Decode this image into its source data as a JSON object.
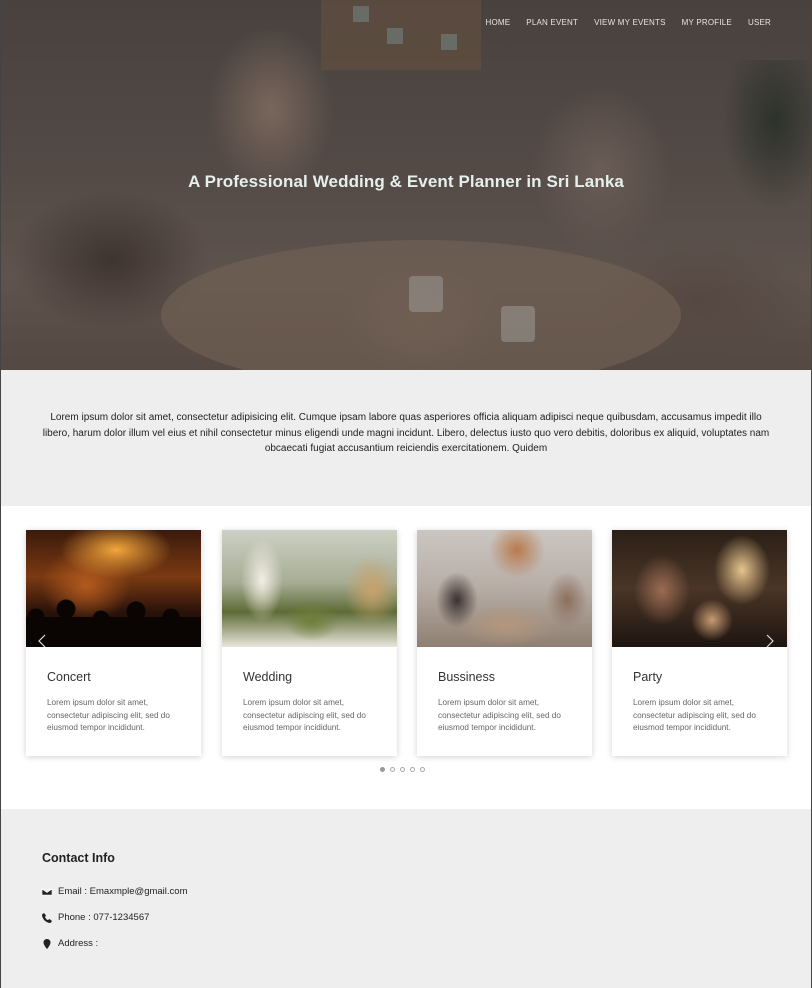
{
  "nav": {
    "items": [
      {
        "label": "HOME"
      },
      {
        "label": "PLAN EVENT"
      },
      {
        "label": "VIEW MY EVENTS"
      },
      {
        "label": "MY PROFILE"
      },
      {
        "label": "USER"
      }
    ]
  },
  "hero": {
    "title": "A Professional Wedding & Event Planner in Sri Lanka"
  },
  "intro": {
    "text": "Lorem ipsum dolor sit amet, consectetur adipisicing elit. Cumque ipsam labore quas asperiores officia aliquam adipisci neque quibusdam, accusamus impedit illo libero, harum dolor illum vel eius et nihil consectetur minus eligendi unde magni incidunt. Libero, delectus iusto quo vero debitis, doloribus ex aliquid, voluptates nam obcaecati fugiat accusantium reiciendis exercitationem. Quidem"
  },
  "carousel": {
    "cards": [
      {
        "title": "Concert",
        "description": "Lorem ipsum dolor sit amet, consectetur adipiscing elit, sed do eiusmod tempor incididunt."
      },
      {
        "title": "Wedding",
        "description": "Lorem ipsum dolor sit amet, consectetur adipiscing elit, sed do eiusmod tempor incididunt."
      },
      {
        "title": "Bussiness",
        "description": "Lorem ipsum dolor sit amet, consectetur adipiscing elit, sed do eiusmod tempor incididunt."
      },
      {
        "title": "Party",
        "description": "Lorem ipsum dolor sit amet, consectetur adipiscing elit, sed do eiusmod tempor incididunt."
      }
    ],
    "prev_icon": "chevron-left-icon",
    "next_icon": "chevron-right-icon",
    "dots": 5,
    "active_dot": 1
  },
  "contact": {
    "heading": "Contact Info",
    "email": "Email : Emaxmple@gmail.com",
    "phone": "Phone : 077-1234567",
    "address": "Address :"
  }
}
